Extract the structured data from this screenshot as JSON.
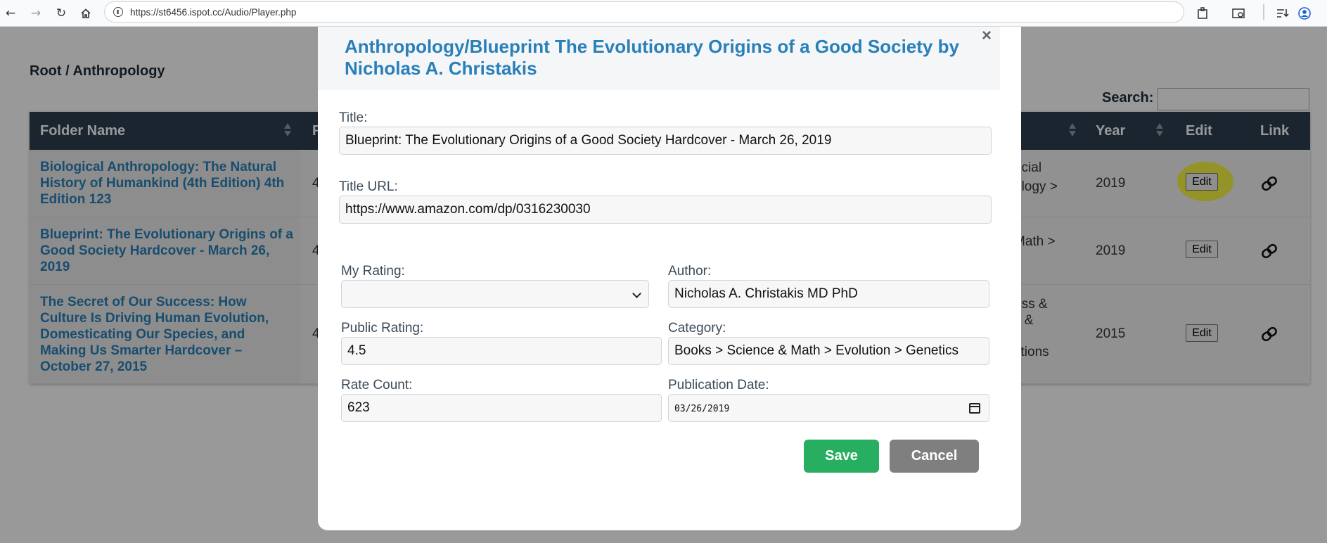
{
  "browser": {
    "url": "https://st6456.ispot.cc/Audio/Player.php",
    "icons": [
      "back-arrow-icon",
      "forward-arrow-icon",
      "reload-icon",
      "home-icon",
      "extensions-icon",
      "cast-icon",
      "reading-list-icon",
      "profile-icon"
    ]
  },
  "page": {
    "breadcrumb": "Root / Anthropology",
    "search_label": "Search:",
    "table": {
      "headers": {
        "folder_name": "Folder Name",
        "col2_partial": "F",
        "year": "Year",
        "edit": "Edit",
        "link": "Link"
      },
      "rows": [
        {
          "name": "Biological Anthropology: The Natural History of Humankind (4th Edition) 4th Edition 123",
          "col2_partial": "4",
          "category_partial": "ocial\nology >",
          "year": "2019",
          "edit_label": "Edit"
        },
        {
          "name": "Blueprint: The Evolutionary Origins of a Good Society Hardcover - March 26, 2019",
          "col2_partial": "4",
          "category_partial": "Math >\ns",
          "year": "2019",
          "edit_label": "Edit"
        },
        {
          "name": "The Secret of Our Success: How Culture Is Driving Human Evolution, Domesticating Our Species, and Making Us Smarter Hardcover – October 27, 2015",
          "col2_partial": "4",
          "category_partial": "ess &\ny &\n\nctions",
          "year": "2015",
          "edit_label": "Edit"
        }
      ]
    }
  },
  "modal": {
    "title": "Anthropology/Blueprint The Evolutionary Origins of a Good Society by Nicholas A. Christakis",
    "close_symbol": "×",
    "fields": {
      "title_label": "Title:",
      "title_value": "Blueprint: The Evolutionary Origins of a Good Society Hardcover - March 26, 2019",
      "title_url_label": "Title URL:",
      "title_url_value": "https://www.amazon.com/dp/0316230030",
      "my_rating_label": "My Rating:",
      "my_rating_value": "",
      "author_label": "Author:",
      "author_value": "Nicholas A. Christakis MD PhD",
      "public_rating_label": "Public Rating:",
      "public_rating_value": "4.5",
      "category_label": "Category:",
      "category_value": "Books > Science & Math > Evolution > Genetics",
      "rate_count_label": "Rate Count:",
      "rate_count_value": "623",
      "publication_date_label": "Publication Date:",
      "publication_date_value": "03/26/2019"
    },
    "save_label": "Save",
    "cancel_label": "Cancel",
    "colors": {
      "save": "#27ae60",
      "cancel": "#7f7f7f",
      "title": "#2980b9"
    }
  }
}
